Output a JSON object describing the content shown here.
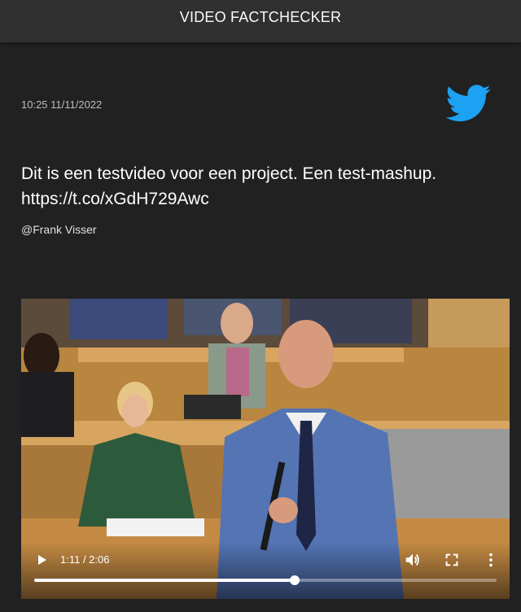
{
  "app": {
    "title": "VIDEO FACTCHECKER"
  },
  "tweet": {
    "timestamp": "10:25 11/11/2022",
    "text_line1": "Dit is een testvideo voor een project. Een test-mashup.",
    "text_line2": "https://t.co/xGdH729Awc",
    "author": "@Frank Visser",
    "source_icon": "twitter-bird-icon",
    "source_color": "#1da1f2"
  },
  "video": {
    "time_display": "1:11 / 2:06",
    "progress_fraction": 0.5635,
    "icons": [
      "play-icon",
      "volume-icon",
      "fullscreen-icon",
      "more-vert-icon"
    ]
  }
}
